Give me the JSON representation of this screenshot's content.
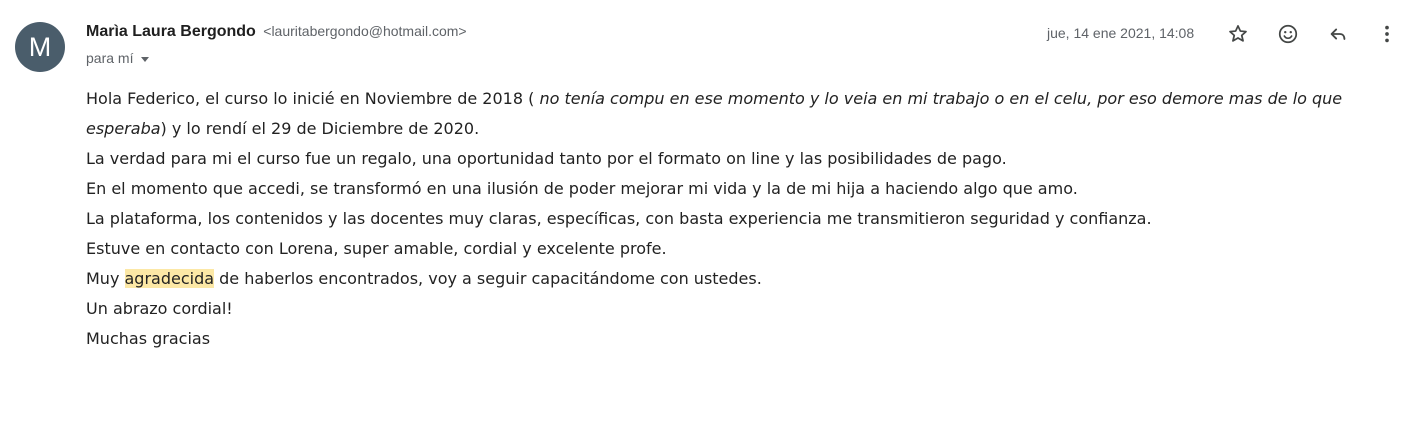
{
  "sender": {
    "avatar_letter": "M",
    "avatar_color": "#4a5d6b",
    "name": "Marìa Laura Bergondo",
    "email": "<lauritabergondo@hotmail.com>"
  },
  "recipient_label": "para mí",
  "date": "jue, 14 ene 2021, 14:08",
  "actions": [
    {
      "name": "star-icon",
      "label": "Destacar"
    },
    {
      "name": "emoji-icon",
      "label": "Reaccionar"
    },
    {
      "name": "reply-icon",
      "label": "Responder"
    },
    {
      "name": "more-vert-icon",
      "label": "Más"
    }
  ],
  "message": {
    "line1_a": "Hola Federico, el curso lo inicié en Noviembre de 2018 ( ",
    "line1_italic": "no tenía compu en ese momento y lo veia en mi trabajo o en el celu, por eso demore mas de lo que esperaba",
    "line1_b": ") y lo rendí el 29 de Diciembre de 2020.",
    "line2": "La verdad para mi el curso fue un regalo, una oportunidad tanto por el formato on line y las posibilidades de pago.",
    "line3": "En el momento que accedi, se transformó en una ilusión de poder mejorar mi vida y la de mi hija a haciendo algo que amo.",
    "line4": "La plataforma, los contenidos y las docentes muy claras, específicas, con basta experiencia me transmitieron seguridad y confianza.",
    "line5": "Estuve en contacto con Lorena, super amable, cordial y excelente profe.",
    "line6_a": "Muy ",
    "line6_highlight": "agradecida",
    "line6_b": " de haberlos encontrados, voy a seguir capacitándome con ustedes.",
    "line7": "Un abrazo cordial!",
    "line8": "Muchas gracias"
  },
  "colors": {
    "highlight": "#fce8a6",
    "icon": "#444746",
    "secondary_text": "#5f6368"
  }
}
